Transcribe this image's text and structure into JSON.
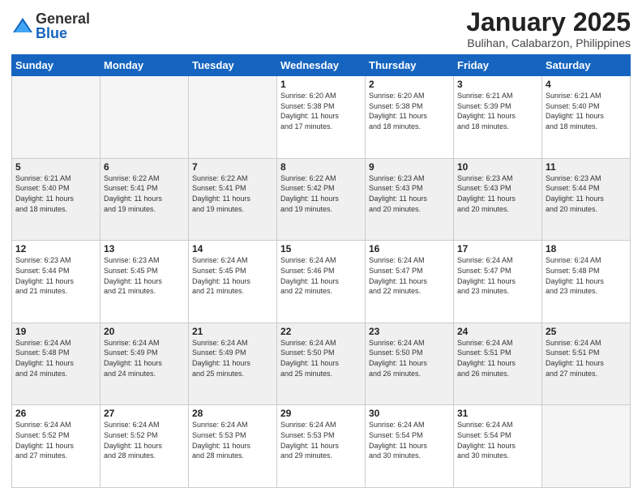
{
  "logo": {
    "general": "General",
    "blue": "Blue"
  },
  "title": "January 2025",
  "subtitle": "Bulihan, Calabarzon, Philippines",
  "weekdays": [
    "Sunday",
    "Monday",
    "Tuesday",
    "Wednesday",
    "Thursday",
    "Friday",
    "Saturday"
  ],
  "weeks": [
    [
      {
        "day": "",
        "info": ""
      },
      {
        "day": "",
        "info": ""
      },
      {
        "day": "",
        "info": ""
      },
      {
        "day": "1",
        "info": "Sunrise: 6:20 AM\nSunset: 5:38 PM\nDaylight: 11 hours\nand 17 minutes."
      },
      {
        "day": "2",
        "info": "Sunrise: 6:20 AM\nSunset: 5:38 PM\nDaylight: 11 hours\nand 18 minutes."
      },
      {
        "day": "3",
        "info": "Sunrise: 6:21 AM\nSunset: 5:39 PM\nDaylight: 11 hours\nand 18 minutes."
      },
      {
        "day": "4",
        "info": "Sunrise: 6:21 AM\nSunset: 5:40 PM\nDaylight: 11 hours\nand 18 minutes."
      }
    ],
    [
      {
        "day": "5",
        "info": "Sunrise: 6:21 AM\nSunset: 5:40 PM\nDaylight: 11 hours\nand 18 minutes."
      },
      {
        "day": "6",
        "info": "Sunrise: 6:22 AM\nSunset: 5:41 PM\nDaylight: 11 hours\nand 19 minutes."
      },
      {
        "day": "7",
        "info": "Sunrise: 6:22 AM\nSunset: 5:41 PM\nDaylight: 11 hours\nand 19 minutes."
      },
      {
        "day": "8",
        "info": "Sunrise: 6:22 AM\nSunset: 5:42 PM\nDaylight: 11 hours\nand 19 minutes."
      },
      {
        "day": "9",
        "info": "Sunrise: 6:23 AM\nSunset: 5:43 PM\nDaylight: 11 hours\nand 20 minutes."
      },
      {
        "day": "10",
        "info": "Sunrise: 6:23 AM\nSunset: 5:43 PM\nDaylight: 11 hours\nand 20 minutes."
      },
      {
        "day": "11",
        "info": "Sunrise: 6:23 AM\nSunset: 5:44 PM\nDaylight: 11 hours\nand 20 minutes."
      }
    ],
    [
      {
        "day": "12",
        "info": "Sunrise: 6:23 AM\nSunset: 5:44 PM\nDaylight: 11 hours\nand 21 minutes."
      },
      {
        "day": "13",
        "info": "Sunrise: 6:23 AM\nSunset: 5:45 PM\nDaylight: 11 hours\nand 21 minutes."
      },
      {
        "day": "14",
        "info": "Sunrise: 6:24 AM\nSunset: 5:45 PM\nDaylight: 11 hours\nand 21 minutes."
      },
      {
        "day": "15",
        "info": "Sunrise: 6:24 AM\nSunset: 5:46 PM\nDaylight: 11 hours\nand 22 minutes."
      },
      {
        "day": "16",
        "info": "Sunrise: 6:24 AM\nSunset: 5:47 PM\nDaylight: 11 hours\nand 22 minutes."
      },
      {
        "day": "17",
        "info": "Sunrise: 6:24 AM\nSunset: 5:47 PM\nDaylight: 11 hours\nand 23 minutes."
      },
      {
        "day": "18",
        "info": "Sunrise: 6:24 AM\nSunset: 5:48 PM\nDaylight: 11 hours\nand 23 minutes."
      }
    ],
    [
      {
        "day": "19",
        "info": "Sunrise: 6:24 AM\nSunset: 5:48 PM\nDaylight: 11 hours\nand 24 minutes."
      },
      {
        "day": "20",
        "info": "Sunrise: 6:24 AM\nSunset: 5:49 PM\nDaylight: 11 hours\nand 24 minutes."
      },
      {
        "day": "21",
        "info": "Sunrise: 6:24 AM\nSunset: 5:49 PM\nDaylight: 11 hours\nand 25 minutes."
      },
      {
        "day": "22",
        "info": "Sunrise: 6:24 AM\nSunset: 5:50 PM\nDaylight: 11 hours\nand 25 minutes."
      },
      {
        "day": "23",
        "info": "Sunrise: 6:24 AM\nSunset: 5:50 PM\nDaylight: 11 hours\nand 26 minutes."
      },
      {
        "day": "24",
        "info": "Sunrise: 6:24 AM\nSunset: 5:51 PM\nDaylight: 11 hours\nand 26 minutes."
      },
      {
        "day": "25",
        "info": "Sunrise: 6:24 AM\nSunset: 5:51 PM\nDaylight: 11 hours\nand 27 minutes."
      }
    ],
    [
      {
        "day": "26",
        "info": "Sunrise: 6:24 AM\nSunset: 5:52 PM\nDaylight: 11 hours\nand 27 minutes."
      },
      {
        "day": "27",
        "info": "Sunrise: 6:24 AM\nSunset: 5:52 PM\nDaylight: 11 hours\nand 28 minutes."
      },
      {
        "day": "28",
        "info": "Sunrise: 6:24 AM\nSunset: 5:53 PM\nDaylight: 11 hours\nand 28 minutes."
      },
      {
        "day": "29",
        "info": "Sunrise: 6:24 AM\nSunset: 5:53 PM\nDaylight: 11 hours\nand 29 minutes."
      },
      {
        "day": "30",
        "info": "Sunrise: 6:24 AM\nSunset: 5:54 PM\nDaylight: 11 hours\nand 30 minutes."
      },
      {
        "day": "31",
        "info": "Sunrise: 6:24 AM\nSunset: 5:54 PM\nDaylight: 11 hours\nand 30 minutes."
      },
      {
        "day": "",
        "info": ""
      }
    ]
  ]
}
